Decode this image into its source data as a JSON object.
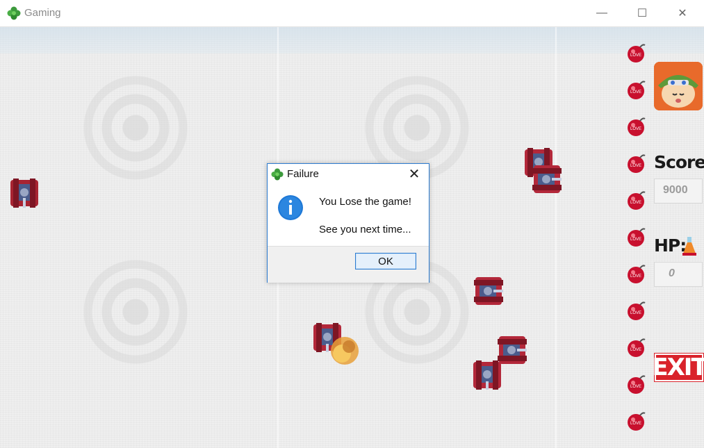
{
  "window": {
    "title": "Gaming",
    "icon": "green-clover-icon",
    "controls": {
      "minimize": "—",
      "maximize": "☐",
      "close": "✕"
    }
  },
  "sidebar": {
    "score_label": "Score:",
    "score_value": "9000",
    "hp_label": "HP:",
    "hp_value": "0",
    "exit_label": "EXIT",
    "bomb_count": 11
  },
  "dialog": {
    "title": "Failure",
    "line1": "You Lose the game!",
    "line2": "See you next time...",
    "ok_label": "OK",
    "close_glyph": "✕",
    "icon": "info-icon"
  },
  "colors": {
    "accent": "#2b7bd0",
    "exit": "#d9232b",
    "bomb": "#c8102e",
    "tank": "#b3283a"
  }
}
